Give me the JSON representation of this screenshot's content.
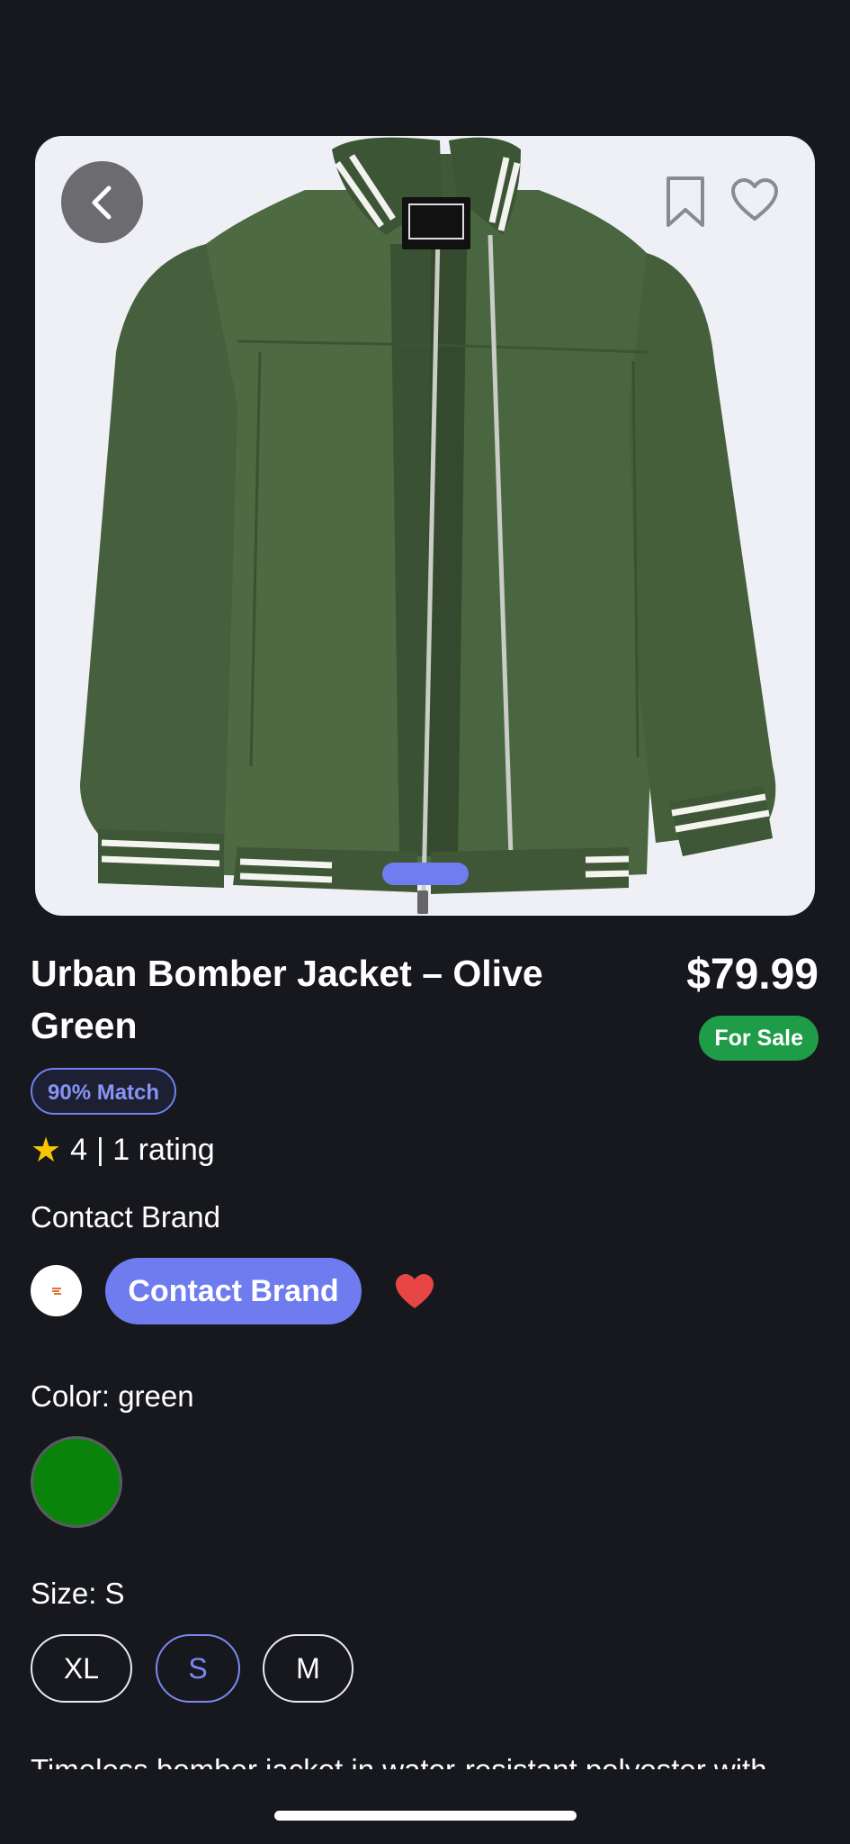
{
  "product": {
    "title": "Urban Bomber Jacket – Olive Green",
    "price": "$79.99",
    "sale_badge": "For Sale",
    "match_badge": "90% Match",
    "rating_value": "4",
    "rating_count": "| 1 rating",
    "description": "Timeless bomber jacket in water-resistant polyester with"
  },
  "contact": {
    "section_label": "Contact Brand",
    "button_label": "Contact Brand"
  },
  "color": {
    "label": "Color: green",
    "selected_hex": "#0a830a"
  },
  "size": {
    "label": "Size: S",
    "options": [
      "XL",
      "S",
      "M"
    ],
    "selected": "S"
  },
  "gallery": {
    "current_page": 1
  },
  "icons": {
    "back": "chevron-left-icon",
    "bookmark": "bookmark-icon",
    "favorite_outline": "heart-outline-icon",
    "favorite_filled": "heart-filled-icon",
    "rating": "star-icon"
  },
  "colors": {
    "accent": "#6f7cf0",
    "sale": "#1f9c48",
    "star": "#f7c600",
    "heart": "#e84545",
    "background": "#17181d"
  }
}
